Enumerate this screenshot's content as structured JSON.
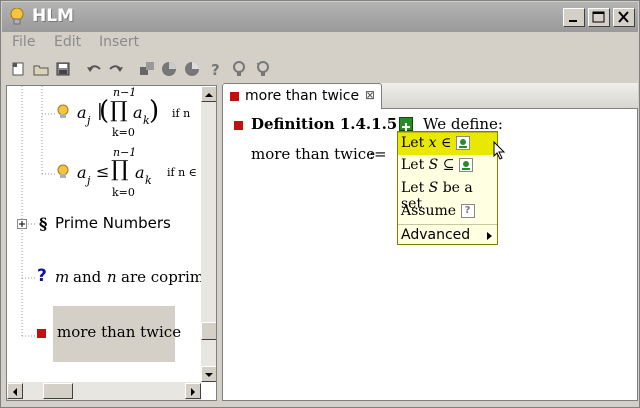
{
  "window": {
    "title": "HLM"
  },
  "menubar": {
    "items": [
      "File",
      "Edit",
      "Insert"
    ]
  },
  "toolbar": {
    "icons": [
      "new-icon",
      "open-icon",
      "save-icon",
      "undo-icon",
      "redo-icon",
      "insert-icon",
      "pie-icon",
      "pie2-icon",
      "help-icon",
      "hint-icon",
      "hint2-icon"
    ]
  },
  "tree": {
    "item1": {
      "sym1": "a",
      "sub1": "j",
      "bar": "|",
      "prod_upper": "n−1",
      "prod_sym": "∏",
      "sym2": "a",
      "sub2": "k",
      "prod_lower": "k=0",
      "trail": "if n"
    },
    "item2": {
      "sym1": "a",
      "sub1": "j",
      "rel": "≤",
      "prod_upper": "n−1",
      "prod_sym": "∏",
      "sym2": "a",
      "sub2": "k",
      "prod_lower": "k=0",
      "trail": "if n ∈"
    },
    "section": {
      "glyph": "§",
      "label": "Prime Numbers"
    },
    "question": {
      "glyph": "?",
      "m": "m",
      "and": "and",
      "n": "n",
      "rest": "are coprim"
    },
    "selected": {
      "label": "more than twice"
    }
  },
  "tab": {
    "label": "more than twice",
    "close_glyph": "⊠"
  },
  "editor": {
    "definition": "Definition 1.4.1.51.",
    "we_define": "We define:",
    "term": "more than twice",
    "assign": ":="
  },
  "popup": {
    "items": [
      {
        "pre": "Let ",
        "var": "x",
        "post": " ∈ "
      },
      {
        "pre": "Let ",
        "var": "S",
        "post": " ⊆ "
      },
      {
        "pre": "Let ",
        "var": "S",
        "post": " be a set"
      },
      {
        "pre": "Assume ",
        "var": "",
        "post": ""
      }
    ],
    "advanced": "Advanced",
    "assume_glyph": "?"
  }
}
